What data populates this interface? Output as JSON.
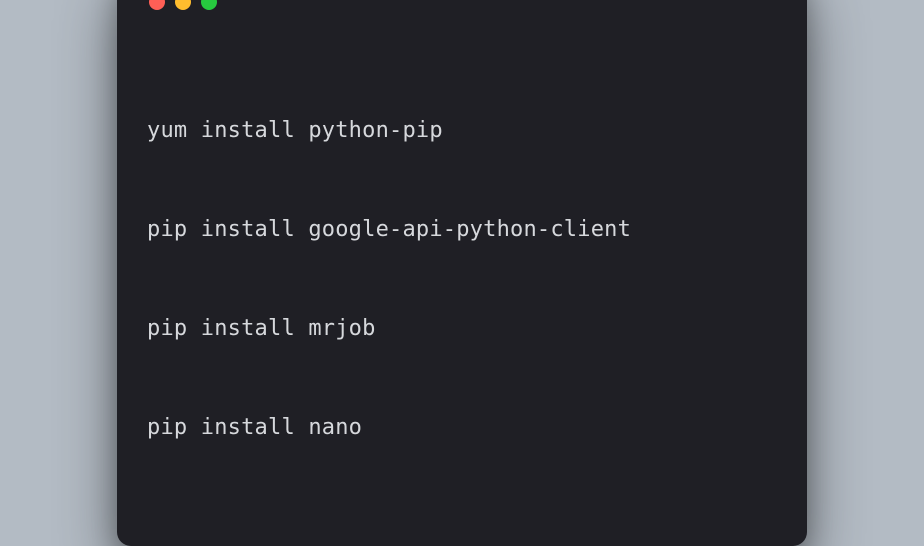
{
  "terminal": {
    "traffic_lights": {
      "red": "#ff5f56",
      "yellow": "#ffbd2e",
      "green": "#27c93f"
    },
    "lines": [
      "yum install python-pip",
      "pip install google-api-python-client",
      "pip install mrjob",
      "pip install nano"
    ]
  }
}
